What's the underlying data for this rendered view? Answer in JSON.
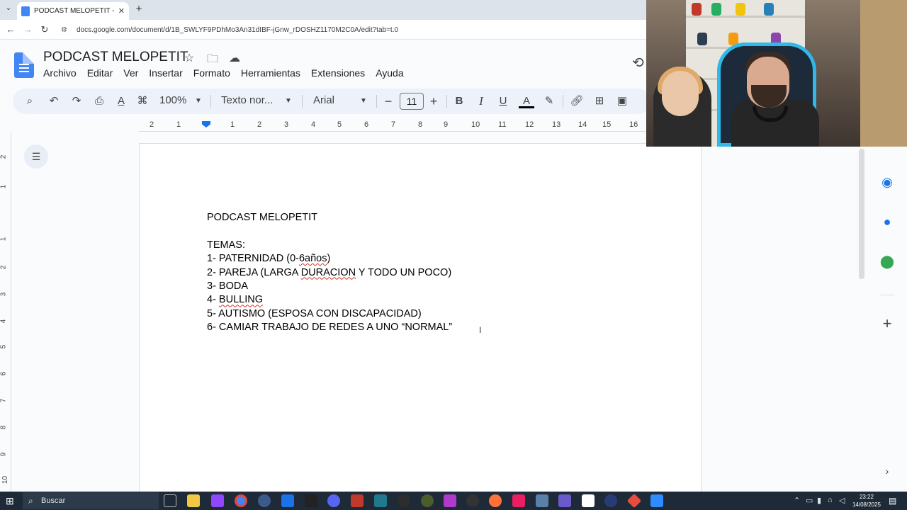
{
  "browser": {
    "tab_title": "PODCAST MELOPETIT - Docum",
    "tab_close": "✕",
    "new_tab": "+",
    "url": "docs.google.com/document/d/1B_SWLYF9PDhMo3An31dIBF-jGnw_rDOSHZ1170M2C0A/edit?tab=t.0"
  },
  "docs": {
    "title": "PODCAST MELOPETIT",
    "menu": [
      "Archivo",
      "Editar",
      "Ver",
      "Insertar",
      "Formato",
      "Herramientas",
      "Extensiones",
      "Ayuda"
    ],
    "toolbar": {
      "zoom": "100%",
      "style": "Texto nor...",
      "font": "Arial",
      "font_size": "11"
    },
    "ruler_numbers": [
      "2",
      "1",
      "1",
      "2",
      "3",
      "4",
      "5",
      "6",
      "7",
      "8",
      "9",
      "10",
      "11",
      "12",
      "13",
      "14",
      "15",
      "16"
    ],
    "vruler_numbers": [
      "2",
      "1",
      "1",
      "2",
      "3",
      "4",
      "5",
      "6",
      "7",
      "8",
      "9",
      "10"
    ],
    "body": {
      "heading": "PODCAST MELOPETIT",
      "temas_label": "TEMAS:",
      "items": [
        {
          "pre": "1- PATERNIDAD (0-",
          "err": "6años",
          "post": ")"
        },
        {
          "pre": "2- PAREJA (LARGA ",
          "err": "DURACION",
          "post": " Y TODO UN POCO)"
        },
        {
          "pre": "3- BODA",
          "err": "",
          "post": ""
        },
        {
          "pre": "4- ",
          "err": "BULLING",
          "post": ""
        },
        {
          "pre": "5- AUTISMO (ESPOSA CON DISCAPACIDAD)",
          "err": "",
          "post": ""
        },
        {
          "pre": "6- CAMIAR TRABAJO DE REDES A UNO “NORMAL”",
          "err": "",
          "post": ""
        }
      ]
    }
  },
  "taskbar": {
    "search_placeholder": "Buscar",
    "time": "23:22",
    "date": "14/08/2025"
  },
  "colors": {
    "docs_blue": "#4285f4",
    "toolbar_bg": "#edf2fa",
    "webcam_chair_accent": "#2fb8e8",
    "taskbar_bg": "#1e2a38"
  }
}
